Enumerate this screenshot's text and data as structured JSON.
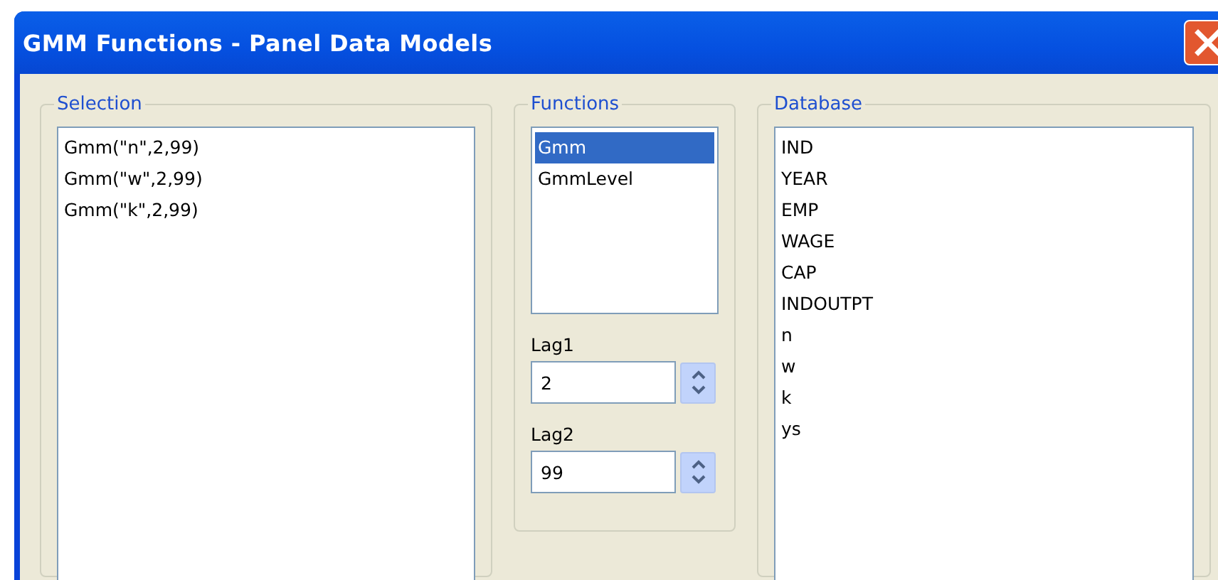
{
  "window": {
    "title": "GMM Functions - Panel Data Models"
  },
  "selection": {
    "legend": "Selection",
    "items": [
      "Gmm(\"n\",2,99)",
      "Gmm(\"w\",2,99)",
      "Gmm(\"k\",2,99)"
    ]
  },
  "functions": {
    "legend": "Functions",
    "items": [
      {
        "label": "Gmm",
        "selected": true
      },
      {
        "label": "GmmLevel",
        "selected": false
      }
    ],
    "lags": [
      {
        "label": "Lag1",
        "value": "2"
      },
      {
        "label": "Lag2",
        "value": "99"
      }
    ]
  },
  "database": {
    "legend": "Database",
    "items": [
      "IND",
      "YEAR",
      "EMP",
      "WAGE",
      "CAP",
      "INDOUTPT",
      "n",
      "w",
      "k",
      "ys"
    ]
  }
}
